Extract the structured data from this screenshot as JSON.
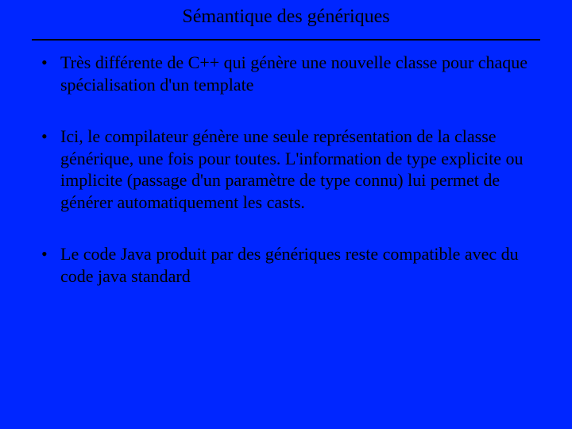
{
  "slide": {
    "title": "Sémantique des génériques",
    "bullets": [
      "Très différente de C++ qui génère une nouvelle classe pour chaque spécialisation d'un template",
      "Ici, le compilateur génère une seule représentation de la classe générique, une fois pour toutes. L'information de type explicite ou implicite (passage d'un paramètre de type connu) lui permet de générer automatiquement les casts.",
      "Le code Java produit par des génériques reste compatible avec du code java standard"
    ]
  }
}
